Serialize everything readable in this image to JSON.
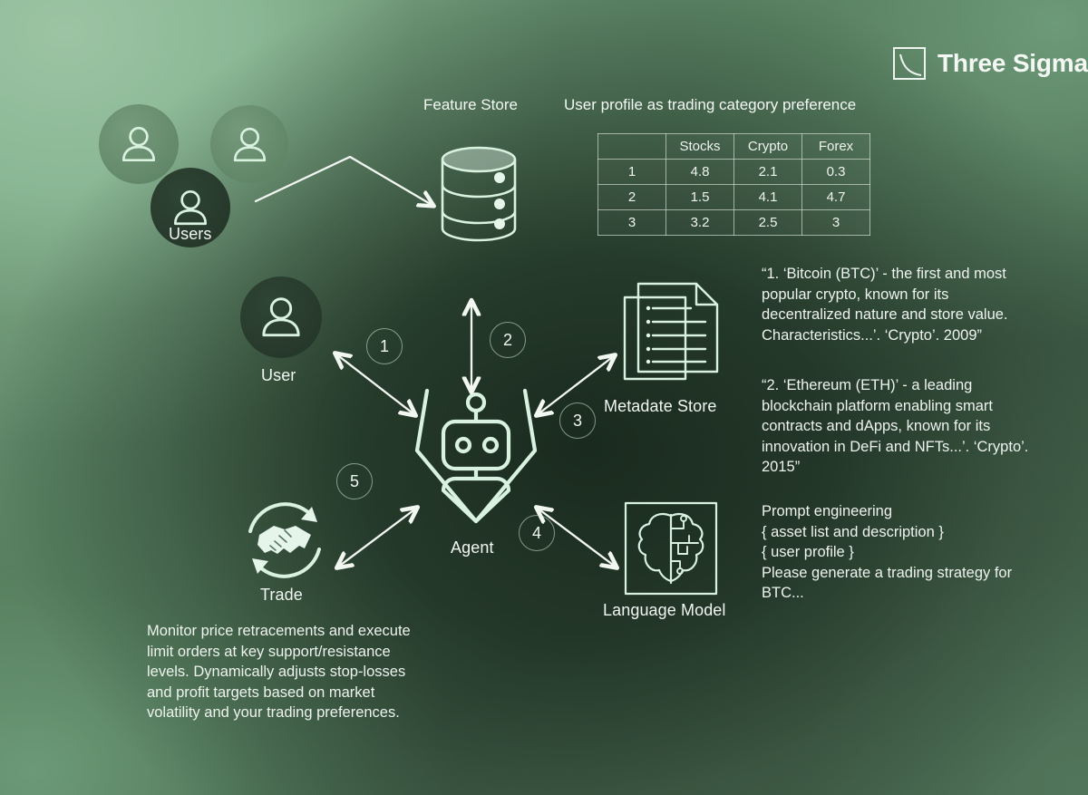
{
  "brand": {
    "name": "Three Sigma",
    "logo_icon": "three-sigma-mark"
  },
  "headers": {
    "feature_store": "Feature Store",
    "user_profile": "User profile as trading category preference"
  },
  "table": {
    "columns": [
      "",
      "Stocks",
      "Crypto",
      "Forex"
    ],
    "rows": [
      {
        "id": "1",
        "stocks": "4.8",
        "crypto": "2.1",
        "forex": "0.3"
      },
      {
        "id": "2",
        "stocks": "1.5",
        "crypto": "4.1",
        "forex": "4.7"
      },
      {
        "id": "3",
        "stocks": "3.2",
        "crypto": "2.5",
        "forex": "3"
      }
    ]
  },
  "nodes": {
    "users": {
      "label": "Users",
      "icon": "users-group-icon"
    },
    "feature_store": {
      "label": "",
      "icon": "database-icon"
    },
    "user": {
      "label": "User",
      "icon": "user-icon"
    },
    "agent": {
      "label": "Agent",
      "icon": "robot-agent-icon"
    },
    "metadata_store": {
      "label": "Metadate Store",
      "icon": "documents-icon"
    },
    "language_model": {
      "label": "Language Model",
      "icon": "brain-chip-icon"
    },
    "trade": {
      "label": "Trade",
      "icon": "handshake-refresh-icon"
    }
  },
  "steps": [
    {
      "number": "1",
      "from": "user",
      "to": "agent"
    },
    {
      "number": "2",
      "from": "feature-store",
      "to": "agent"
    },
    {
      "number": "3",
      "from": "agent",
      "to": "metadata-store"
    },
    {
      "number": "4",
      "from": "agent",
      "to": "language-model"
    },
    {
      "number": "5",
      "from": "agent",
      "to": "trade"
    }
  ],
  "annotations": {
    "metadata_sample_1": "“1. ‘Bitcoin (BTC)’ - the first and most popular crypto, known for its decentralized nature and store value. Characteristics...’. ‘Crypto’. 2009”",
    "metadata_sample_2": "“2. ‘Ethereum (ETH)’ - a leading blockchain platform enabling smart contracts and dApps, known for its innovation in DeFi and NFTs...’. ‘Crypto’. 2015”",
    "prompt_engineering": "Prompt engineering\n{ asset list and description }\n{ user profile }\nPlease generate a trading strategy for BTC...",
    "trade_strategy": "Monitor price retracements and execute limit orders at key support/resistance levels. Dynamically adjusts stop-losses and profit targets based on market volatility and your trading preferences."
  },
  "colors": {
    "background_light": "#8cba97",
    "background_dark": "#2b3b2e",
    "background_mid": "#44624a",
    "stroke_light": "#d9f2e0",
    "text": "#f2f6f2"
  }
}
